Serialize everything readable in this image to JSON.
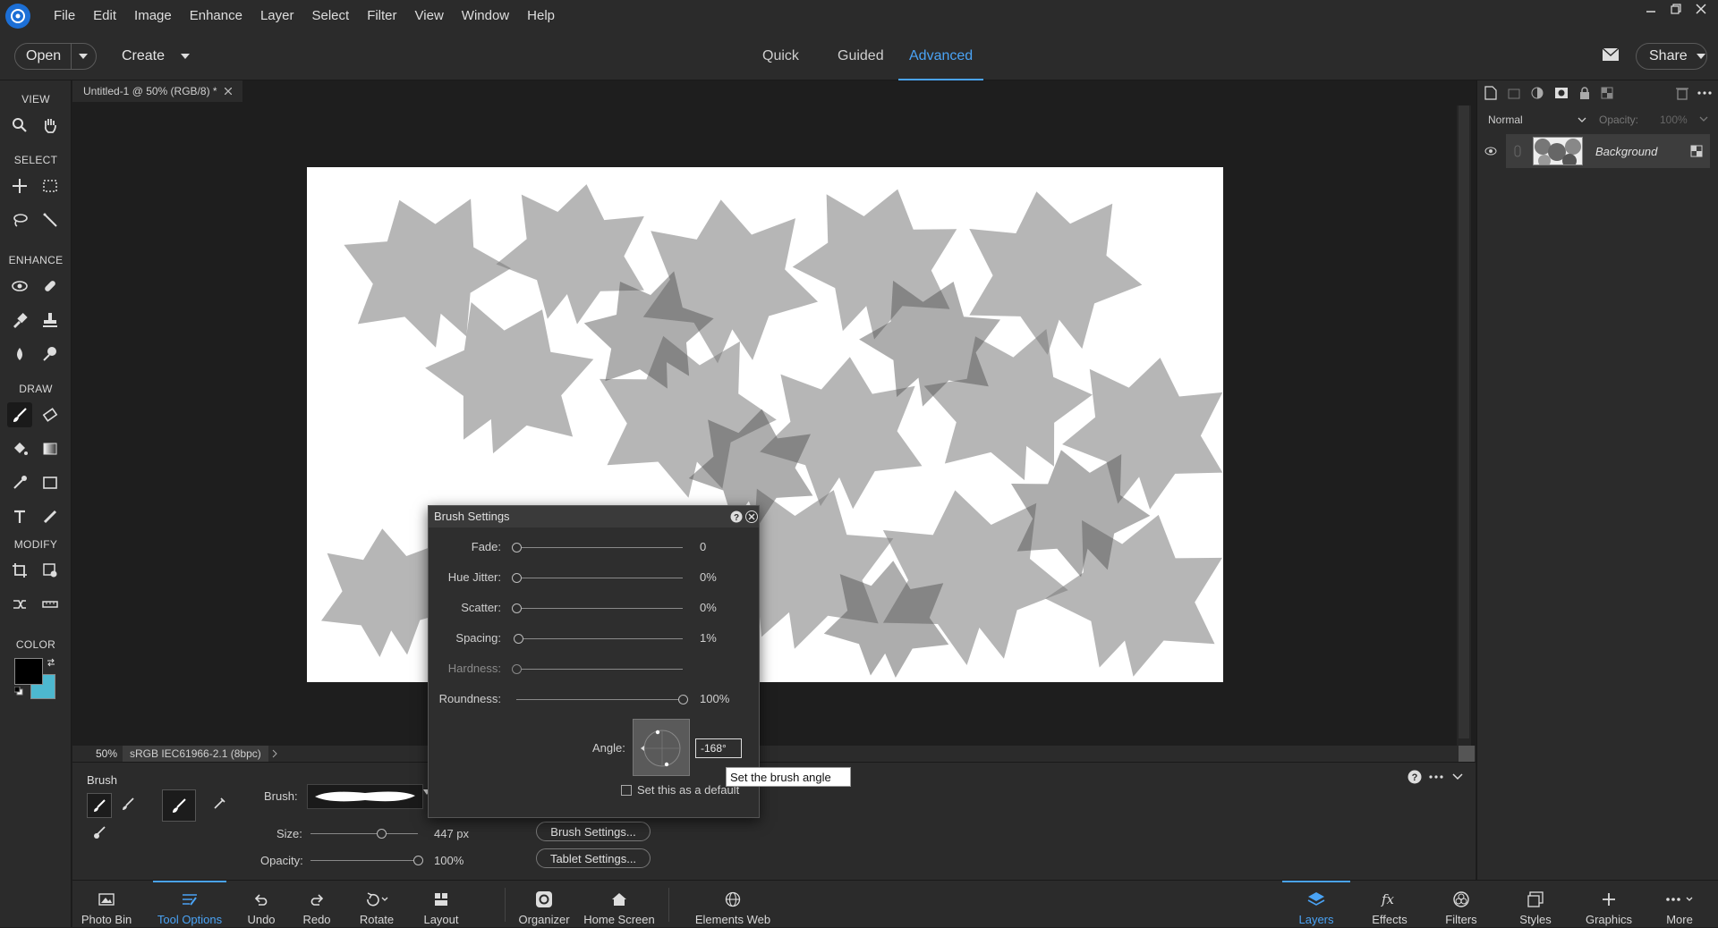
{
  "menu": {
    "items": [
      "File",
      "Edit",
      "Image",
      "Enhance",
      "Layer",
      "Select",
      "Filter",
      "View",
      "Window",
      "Help"
    ]
  },
  "topbar": {
    "open_label": "Open",
    "create_label": "Create",
    "modes": [
      "Quick",
      "Guided",
      "Advanced"
    ],
    "active_mode": "Advanced",
    "share_label": "Share"
  },
  "toolbox": {
    "sections": [
      "VIEW",
      "SELECT",
      "ENHANCE",
      "DRAW",
      "MODIFY",
      "COLOR"
    ],
    "foreground_color": "#000000",
    "background_color": "#4db8cf"
  },
  "document": {
    "tab_title": "Untitled-1 @ 50% (RGB/8) *",
    "zoom": "50%",
    "color_profile": "sRGB IEC61966-2.1 (8bpc)"
  },
  "brush_settings": {
    "title": "Brush Settings",
    "rows": [
      {
        "label": "Fade:",
        "value": "0",
        "fraction": 0,
        "enabled": true
      },
      {
        "label": "Hue Jitter:",
        "value": "0%",
        "fraction": 0,
        "enabled": true
      },
      {
        "label": "Scatter:",
        "value": "0%",
        "fraction": 0,
        "enabled": true
      },
      {
        "label": "Spacing:",
        "value": "1%",
        "fraction": 0.01,
        "enabled": true
      },
      {
        "label": "Hardness:",
        "value": "",
        "fraction": 0,
        "enabled": false
      },
      {
        "label": "Roundness:",
        "value": "100%",
        "fraction": 1,
        "enabled": true
      }
    ],
    "angle_label": "Angle:",
    "angle_value": "-168°",
    "default_label": "Set this as a default",
    "tooltip": "Set the brush angle"
  },
  "tool_options": {
    "tool_name": "Brush",
    "brush_label": "Brush:",
    "size_label": "Size:",
    "size_value": "447 px",
    "size_fraction": 0.66,
    "opacity_label": "Opacity:",
    "opacity_value": "100%",
    "opacity_fraction": 1,
    "brush_settings_button": "Brush Settings...",
    "tablet_settings_button": "Tablet Settings..."
  },
  "layers_panel": {
    "blend_mode": "Normal",
    "opacity_label": "Opacity:",
    "opacity_value": "100%",
    "layer_name": "Background"
  },
  "taskbar": {
    "left": [
      "Photo Bin",
      "Tool Options",
      "Undo",
      "Redo",
      "Rotate",
      "Layout",
      "Organizer",
      "Home Screen",
      "Elements Web"
    ],
    "right": [
      "Layers",
      "Effects",
      "Filters",
      "Styles",
      "Graphics",
      "More"
    ],
    "active_left": "Tool Options",
    "active_right": "Layers",
    "accent_color": "#4aa3f5"
  }
}
